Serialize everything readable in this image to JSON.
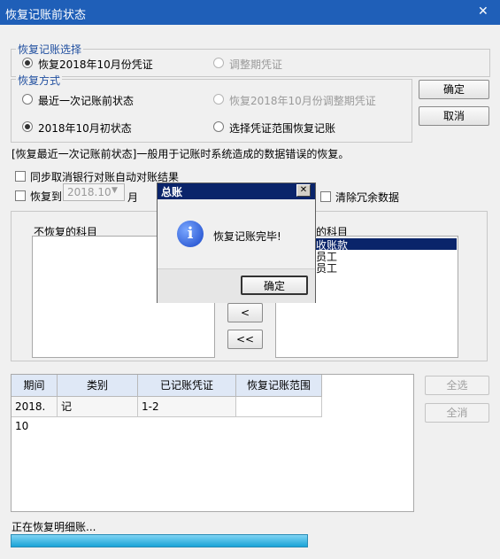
{
  "window": {
    "title": "恢复记账前状态"
  },
  "select_group": {
    "legend": "恢复记账选择",
    "opt1": "恢复2018年10月份凭证",
    "opt2": "调整期凭证"
  },
  "mode_group": {
    "legend": "恢复方式",
    "opt1": "最近一次记账前状态",
    "opt2": "恢复2018年10月份调整期凭证",
    "opt3": "2018年10月初状态",
    "opt4": "选择凭证范围恢复记账"
  },
  "buttons": {
    "ok": "确定",
    "cancel": "取消",
    "select_all": "全选",
    "deselect_all": "全消",
    "move_left": "<",
    "move_all_left": "<<"
  },
  "hint": "[恢复最近一次记账前状态]一般用于记账时系统造成的数据错误的恢复。",
  "options": {
    "sync_bank": "同步取消银行对账自动对账结果",
    "restore_to": "恢复到",
    "period_value": "2018.10",
    "month": "月",
    "clear_redundant": "清除冗余数据"
  },
  "subjects": {
    "left_title": "不恢复的科目",
    "right_title_partial": "的科目",
    "right_items": [
      "收账款",
      "员工",
      "员工"
    ]
  },
  "table": {
    "headers": [
      "期间",
      "类别",
      "已记账凭证",
      "恢复记账范围"
    ],
    "rows": [
      [
        "2018. 10",
        "记",
        "1-2",
        ""
      ]
    ]
  },
  "status": {
    "text": "正在恢复明细账...",
    "progress": 1.0
  },
  "dialog": {
    "title": "总账",
    "message": "恢复记账完毕!",
    "ok": "确定"
  }
}
